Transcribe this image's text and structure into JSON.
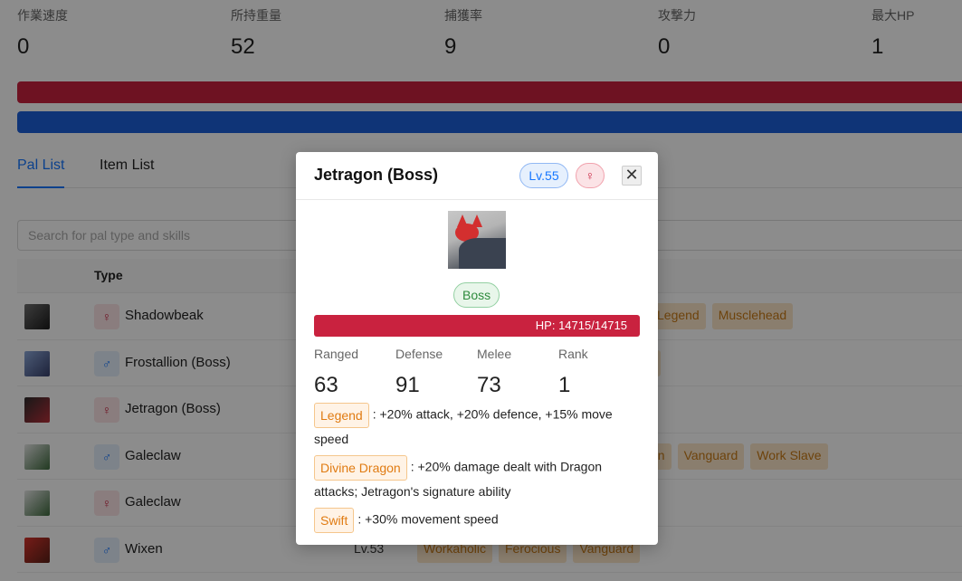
{
  "stats": [
    {
      "title": "作業速度",
      "value": "0"
    },
    {
      "title": "所持重量",
      "value": "52"
    },
    {
      "title": "捕獲率",
      "value": "9"
    },
    {
      "title": "攻撃力",
      "value": "0"
    },
    {
      "title": "最大HP",
      "value": "1"
    }
  ],
  "tabs": {
    "pal_list": "Pal List",
    "item_list": "Item List"
  },
  "search": {
    "placeholder": "Search for pal type and skills"
  },
  "table": {
    "header_type": "Type",
    "rows": [
      {
        "name": "Shadowbeak",
        "gender": "♀",
        "level": "",
        "skills": [
          "Legend",
          "Musclehead"
        ]
      },
      {
        "name": "Frostallion (Boss)",
        "gender": "♂",
        "level": "",
        "skills": [
          "t"
        ]
      },
      {
        "name": "Jetragon (Boss)",
        "gender": "♀",
        "level": "",
        "skills": []
      },
      {
        "name": "Galeclaw",
        "gender": "♂",
        "level": "",
        "skills": [
          "an",
          "Vanguard",
          "Work Slave"
        ]
      },
      {
        "name": "Galeclaw",
        "gender": "♀",
        "level": "",
        "skills": []
      },
      {
        "name": "Wixen",
        "gender": "♂",
        "level": "Lv.53",
        "skills": [
          "Workaholic",
          "Ferocious",
          "Vanguard"
        ]
      }
    ]
  },
  "modal": {
    "title": "Jetragon (Boss)",
    "level": "Lv.55",
    "gender": "♀",
    "close_symbol": "✕",
    "boss_tag": "Boss",
    "hp_text": "HP: 14715/14715",
    "stats": [
      {
        "title": "Ranged",
        "value": "63"
      },
      {
        "title": "Defense",
        "value": "91"
      },
      {
        "title": "Melee",
        "value": "73"
      },
      {
        "title": "Rank",
        "value": "1"
      }
    ],
    "passives": [
      {
        "name": "Legend",
        "desc": ": +20% attack, +20% defence, +15% move speed"
      },
      {
        "name": "Divine Dragon",
        "desc": ": +20% damage dealt with Dragon attacks; Jetragon's signature ability"
      },
      {
        "name": "Swift",
        "desc": ": +30% movement speed"
      }
    ]
  },
  "colors": {
    "accent": "#1677ff",
    "hp_red": "#c9223f",
    "blue_bar": "#1c5fd9",
    "skill_orange": "#e07b12",
    "boss_green": "#2e8b3d"
  }
}
